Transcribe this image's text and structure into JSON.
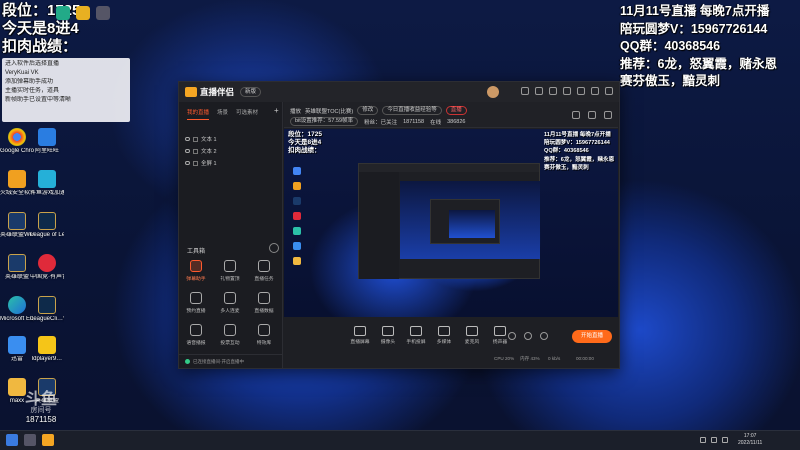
{
  "overlay_left": {
    "line1": "段位：1725",
    "line2": "今天是8进4",
    "line3": "扣肉战绩：",
    "panel_lines": [
      "进入软件后选择直播",
      "VeryKuai VK",
      "",
      "添加弹幕助手成功",
      "主播实时任务，道具",
      "新帧助手已设置中等清晰"
    ]
  },
  "overlay_right": {
    "lines": [
      "11月11号直播  每晚7点开播",
      "陪玩圆梦V：15967726144",
      "QQ群：40368546",
      "推荐：6龙，怒翼霞，赌永恩",
      "赛芬傲玉，黯灵刺"
    ]
  },
  "desktop_icons": [
    {
      "label": "Google Chrome"
    },
    {
      "label": "阿里旺旺"
    },
    {
      "label": "火绒安全软件"
    },
    {
      "label": "斗鱼游戏加速器"
    },
    {
      "label": "英雄联盟WeGame版"
    },
    {
      "label": "League of Legends"
    },
    {
      "label": "英雄联盟"
    },
    {
      "label": "中国竞·有声音"
    },
    {
      "label": "Microsoft Edge"
    },
    {
      "label": "LeagueCli…快捷方式"
    },
    {
      "label": "迅雷"
    },
    {
      "label": "ldplayer9…"
    },
    {
      "label": "maxx"
    },
    {
      "label": "英雄联盟"
    }
  ],
  "app": {
    "name": "直播伴侣",
    "version_badge": "新版",
    "left_tabs": [
      "我的直播",
      "场景",
      "可选素材"
    ],
    "scenes": [
      "文本 1",
      "文本 2",
      "全屏 1"
    ],
    "tools_label": "工具箱",
    "tools": [
      "弹幕助手",
      "礼物置顶",
      "直播任务",
      "预约直播",
      "多人连麦",
      "直播数据",
      "语音播报",
      "投票互动",
      "特效库"
    ],
    "left_status": "已连接直播间·开启直播中",
    "top_bar": {
      "label_title": "播放",
      "stream_title": "英雄联盟TOC(比赛)",
      "badge_edit": "修改",
      "notice_pill": "今日直播收益经验等",
      "badge_live": "直播",
      "setting_label": "bit设置推荐：57.59帧率",
      "follower_label": "粉丝：已关注",
      "fan_count": "1871158",
      "watch_label": "在线",
      "watch_count": "386826"
    },
    "preview_overlay_left": [
      "段位：1725",
      "今天是8进4",
      "扣肉战绩："
    ],
    "preview_overlay_right": [
      "11月11号直播  每晚7点开播",
      "陪玩圆梦V：15967726144",
      "QQ群：40368546",
      "推荐：6龙，怒翼霞，赌永恩",
      "赛芬傲玉，黯灵刺"
    ],
    "controls": [
      "直播屏幕",
      "摄像头",
      "手机投屏",
      "多媒体",
      "麦克风",
      "扬声器"
    ],
    "start_button": "开始直播",
    "status": {
      "cpu": "CPU 20%",
      "memory": "内存 43%",
      "rate": "0 kb/s",
      "time": "00:00:00"
    }
  },
  "watermark": {
    "logo": "斗鱼",
    "sub": "房间号",
    "room_id": "1871158"
  },
  "taskbar": {
    "time": "17:07",
    "date": "2022/11/11"
  }
}
